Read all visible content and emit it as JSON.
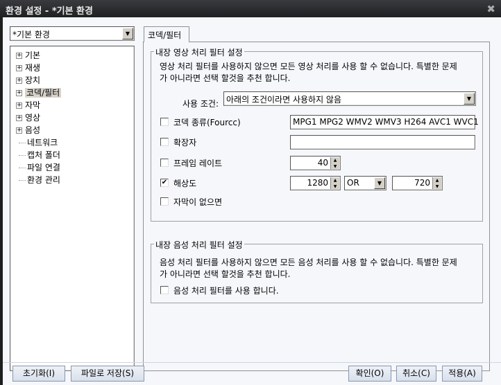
{
  "window": {
    "title": "환경 설정 - *기본 환경",
    "close": "✖"
  },
  "profile_combo": {
    "value": "*기본 환경"
  },
  "tree": [
    {
      "label": "기본",
      "expandable": true
    },
    {
      "label": "재생",
      "expandable": true
    },
    {
      "label": "장치",
      "expandable": true
    },
    {
      "label": "코덱/필터",
      "expandable": true,
      "selected": true
    },
    {
      "label": "자막",
      "expandable": true
    },
    {
      "label": "영상",
      "expandable": true
    },
    {
      "label": "음성",
      "expandable": true
    },
    {
      "label": "네트워크",
      "expandable": false
    },
    {
      "label": "캡처 폴더",
      "expandable": false
    },
    {
      "label": "파일 연결",
      "expandable": false
    },
    {
      "label": "환경 관리",
      "expandable": false
    }
  ],
  "tab": {
    "label": "코덱/필터"
  },
  "video_group": {
    "title": "내장 영상 처리 필터 설정",
    "desc1": "영상 처리 필터를 사용하지 않으면 모든 영상 처리를 사용 할 수 없습니다. 특별한 문제",
    "desc2": "가 아니라면 선택 할것을 추천 합니다.",
    "condition_label": "사용 조건:",
    "condition_value": "아래의 조건이라면 사용하지 않음",
    "codec": {
      "label": "코덱 종류(Fourcc)",
      "checked": false,
      "value": "MPG1 MPG2 WMV2 WMV3 H264 AVC1 WVC1"
    },
    "ext": {
      "label": "확장자",
      "checked": false,
      "value": ""
    },
    "framerate": {
      "label": "프레임 레이트",
      "checked": false,
      "value": "40"
    },
    "resolution": {
      "label": "해상도",
      "checked": true,
      "width": "1280",
      "op": "OR",
      "height": "720"
    },
    "nosub": {
      "label": "자막이 없으면",
      "checked": false
    }
  },
  "audio_group": {
    "title": "내장 음성 처리 필터 설정",
    "desc1": "음성 처리 필터를 사용하지 않으면 모든 음성 처리를 사용 할 수 없습니다. 특별한 문제",
    "desc2": "가 아니라면 선택 할것을 추천 합니다.",
    "use": {
      "label": "음성 처리 필터를 사용 합니다.",
      "checked": false
    }
  },
  "buttons": {
    "reset": "초기화(I)",
    "save_file": "파일로 저장(S)",
    "ok": "확인(O)",
    "cancel": "취소(C)",
    "apply": "적용(A)"
  }
}
